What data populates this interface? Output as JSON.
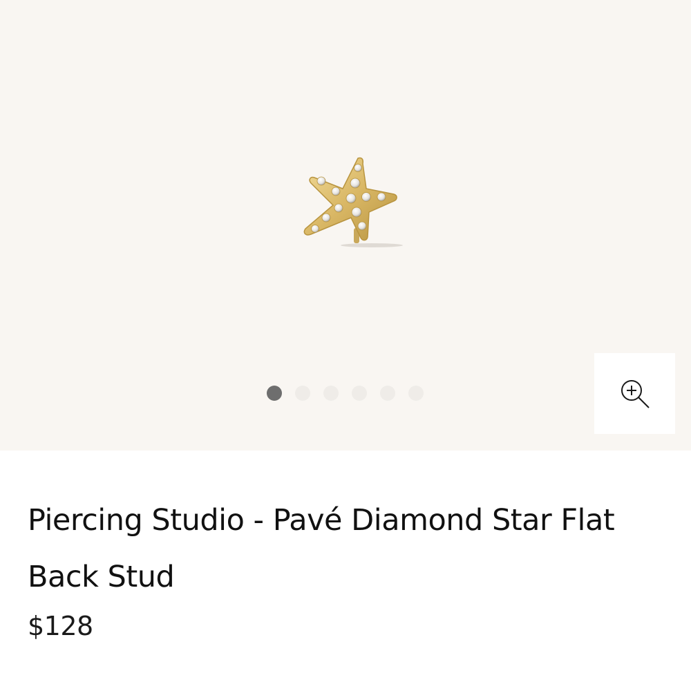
{
  "product": {
    "title": "Piercing Studio - Pavé Diamond Star Flat Back Stud",
    "price": "$128",
    "image_alt": "Pavé Diamond Star Flat Back Stud"
  },
  "gallery": {
    "slide_count": 6,
    "active_slide": 1,
    "background_color": "#f9f6f2",
    "zoom_icon": "zoom-in-icon"
  },
  "colors": {
    "gold": "#d9b765",
    "dot_active": "#6e6e6e",
    "dot_inactive": "#efece8"
  }
}
